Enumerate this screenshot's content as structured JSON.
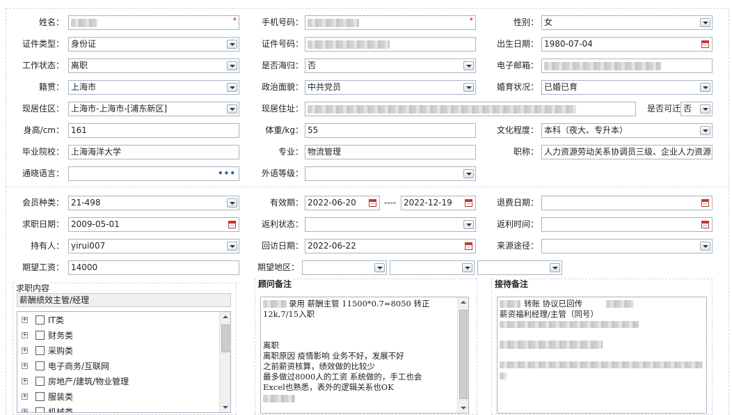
{
  "profile": {
    "name": {
      "label": "姓名：",
      "value": ""
    },
    "phone": {
      "label": "手机号码：",
      "value": ""
    },
    "gender": {
      "label": "性别：",
      "value": "女"
    },
    "id_type": {
      "label": "证件类型：",
      "value": "身份证"
    },
    "id_number": {
      "label": "证件号码：",
      "value": ""
    },
    "birth_date": {
      "label": "出生日期：",
      "value": "1980-07-04"
    },
    "work_status": {
      "label": "工作状态：",
      "value": "离职"
    },
    "overseas_returnee": {
      "label": "是否海归：",
      "value": "否"
    },
    "email": {
      "label": "电子邮箱：",
      "value": ""
    },
    "native_place": {
      "label": "籍贯：",
      "value": "上海市"
    },
    "political_status": {
      "label": "政治面貌：",
      "value": "中共党员"
    },
    "marital_status": {
      "label": "婚育状况：",
      "value": "已婚已育"
    },
    "current_region": {
      "label": "现居住区：",
      "value": "上海市-上海市-[浦东新区]"
    },
    "current_address": {
      "label": "现居住址：",
      "value": ""
    },
    "transferable": {
      "label": "是否可迁",
      "value": "否"
    },
    "height": {
      "label": "身高/cm：",
      "value": "161"
    },
    "weight": {
      "label": "体重/kg：",
      "value": "55"
    },
    "education": {
      "label": "文化程度：",
      "value": "本科（夜大、专升本）"
    },
    "school": {
      "label": "毕业院校：",
      "value": "上海海洋大学"
    },
    "major": {
      "label": "专业：",
      "value": "物流管理"
    },
    "title": {
      "label": "职称：",
      "value": "人力资源劳动关系协调员三级、企业人力资源"
    },
    "language": {
      "label": "通晓语言：",
      "value": ""
    },
    "foreign_language_level": {
      "label": "外语等级：",
      "value": ""
    }
  },
  "membership": {
    "member_type": {
      "label": "会员种类：",
      "value": "21-498"
    },
    "valid_period": {
      "label": "有效期：",
      "start": "2022-06-20",
      "separator": "----",
      "end": "2022-12-19"
    },
    "refund_date": {
      "label": "退费日期：",
      "value": ""
    },
    "job_search_date": {
      "label": "求职日期：",
      "value": "2009-05-01"
    },
    "rebate_status": {
      "label": "返利状态：",
      "value": ""
    },
    "rebate_time": {
      "label": "返利时间：",
      "value": ""
    },
    "holder": {
      "label": "持有人：",
      "value": "yirui007"
    },
    "revisit_date": {
      "label": "回访日期：",
      "value": "2022-06-22"
    },
    "source_channel": {
      "label": "来源途径：",
      "value": ""
    },
    "expected_salary": {
      "label": "期望工资：",
      "value": "14000"
    },
    "expected_region": {
      "label": "期望地区：",
      "values": [
        "",
        "",
        ""
      ]
    }
  },
  "job_content": {
    "title": "求职内容",
    "selected": "薪酬绩效主管/经理",
    "categories": [
      "IT类",
      "财务类",
      "采购类",
      "电子商务/互联网",
      "房地产/建筑/物业管理",
      "服装类",
      "机械类"
    ]
  },
  "consultant_notes": {
    "title": "顾问备注",
    "lines": [
      "录用 薪酬主管 11500*0.7=8050 转正",
      "12k,7/15入职",
      "",
      "",
      "离职",
      "离职原因  疫情影响 业务不好，发展不好",
      "之前薪资核算，绩效做的比较少",
      "最多做过8000人的工资  系统做的，手工也会",
      "Excel也熟悉，表外的逻辑关系也OK",
      ""
    ]
  },
  "reception_notes": {
    "title": "接待备注",
    "lines": [
      "转账  协议已回传",
      "薪资福利经理/主管（同号）"
    ]
  },
  "colors": {
    "border": "#a7b3c2",
    "required": "#d40000",
    "calendar": "#c0392b"
  },
  "icons": [
    "dropdown-arrow-icon",
    "calendar-icon",
    "more-dots-icon",
    "tree-expand-icon",
    "checkbox-icon",
    "scroll-arrow-icon"
  ]
}
